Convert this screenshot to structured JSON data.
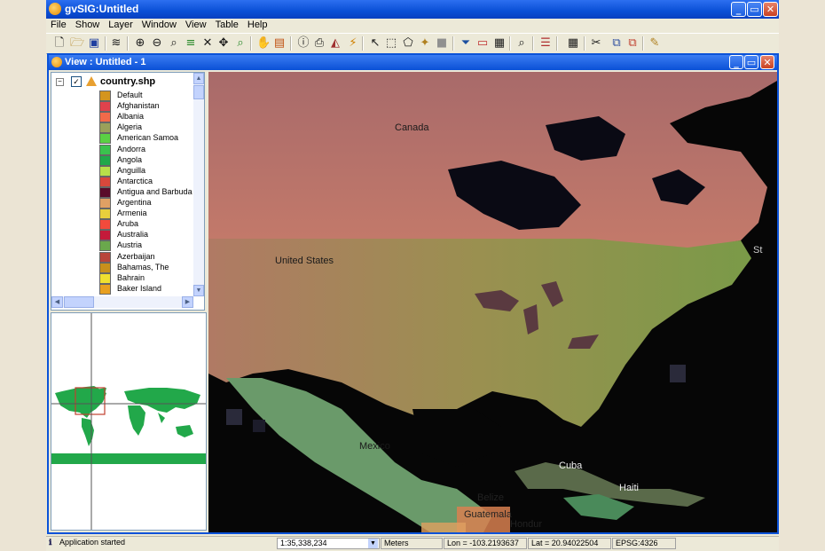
{
  "app": {
    "title": "gvSIG:Untitled"
  },
  "window_controls": {
    "minimize": "_",
    "maximize": "▭",
    "close": "✕"
  },
  "menubar": {
    "items": [
      "File",
      "Show",
      "Layer",
      "Window",
      "View",
      "Table",
      "Help"
    ]
  },
  "toolbar": {
    "icons": [
      "new-icon",
      "open-icon",
      "save-icon",
      "layers-icon",
      "zoom-in-icon",
      "zoom-out-icon",
      "zoom-select-icon",
      "refresh-icon",
      "zoom-full-icon",
      "zoom-extent-icon",
      "zoom-previous-icon",
      "pan-hand-icon",
      "layer-extent-icon",
      "info-icon",
      "print-icon",
      "measure-area-icon",
      "hyperlink-icon",
      "select-pointer-icon",
      "select-rectangle-icon",
      "select-polygon-icon",
      "select-layer-icon",
      "gray-square-icon",
      "filter-icon",
      "rectangle-icon",
      "image-icon",
      "locate-icon",
      "legend-icon",
      "table-icon",
      "tools-icon",
      "copy-icon",
      "paste-icon",
      "edit-icon"
    ]
  },
  "view_window": {
    "title": "View : Untitled - 1"
  },
  "toc": {
    "layer": {
      "name": "country.shp",
      "checked": "✓",
      "expand": "−"
    },
    "categories": [
      {
        "label": "Default",
        "color": "#d4951e"
      },
      {
        "label": "Afghanistan",
        "color": "#e0424c"
      },
      {
        "label": "Albania",
        "color": "#f26a4a"
      },
      {
        "label": "Algeria",
        "color": "#9aa05a"
      },
      {
        "label": "American Samoa",
        "color": "#5ad044"
      },
      {
        "label": "Andorra",
        "color": "#3ac24e"
      },
      {
        "label": "Angola",
        "color": "#20a84a"
      },
      {
        "label": "Anguilla",
        "color": "#b8e04a"
      },
      {
        "label": "Antarctica",
        "color": "#d8483c"
      },
      {
        "label": "Antigua and Barbuda",
        "color": "#5a0c2a"
      },
      {
        "label": "Argentina",
        "color": "#e0a064"
      },
      {
        "label": "Armenia",
        "color": "#e8d03c"
      },
      {
        "label": "Aruba",
        "color": "#f24a3c"
      },
      {
        "label": "Australia",
        "color": "#c41a3a"
      },
      {
        "label": "Austria",
        "color": "#6aa84c"
      },
      {
        "label": "Azerbaijan",
        "color": "#b8443a"
      },
      {
        "label": "Bahamas, The",
        "color": "#c8901c"
      },
      {
        "label": "Bahrain",
        "color": "#f0e030"
      },
      {
        "label": "Baker Island",
        "color": "#e8a020"
      }
    ]
  },
  "map": {
    "labels": [
      "Canada",
      "United States",
      "Mexico",
      "Cuba",
      "Haiti",
      "Belize",
      "Guatemala",
      "Hondur",
      "St"
    ]
  },
  "status": {
    "message": "Application started",
    "scale": "1:35,338,234",
    "units": "Meters",
    "lon": "Lon = -103.2193637",
    "lat": "Lat = 20.94022504",
    "crs": "EPSG:4326"
  }
}
